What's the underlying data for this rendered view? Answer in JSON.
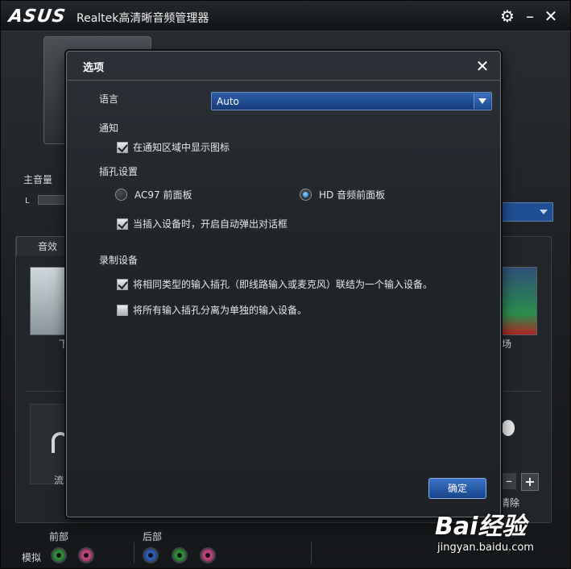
{
  "window": {
    "logo": "ASUS",
    "title": "Realtek高清晰音频管理器"
  },
  "background": {
    "main_volume_label": "主音量",
    "volume_l": "L",
    "sound_effects_tab": "音效",
    "partial_left_label": "下",
    "partial_right_label": "场",
    "partial_left_label2": "流",
    "partial_right_label2": "清除",
    "front_label": "前部",
    "rear_label": "后部",
    "analog_label": "模拟"
  },
  "dialog": {
    "title": "选项",
    "language_label": "语言",
    "language_value": "Auto",
    "notification_label": "通知",
    "show_icon_option": "在通知区域中显示图标",
    "show_icon_checked": true,
    "jack_settings_label": "插孔设置",
    "ac97_option": "AC97 前面板",
    "hd_option": "HD 音频前面板",
    "hd_selected": true,
    "auto_popup_option": "当插入设备时，开启自动弹出对话框",
    "auto_popup_checked": true,
    "recording_label": "录制设备",
    "tie_inputs_option": "将相同类型的输入插孔（即线路输入或麦克风）联结为一个输入设备。",
    "tie_inputs_checked": true,
    "separate_inputs_option": "将所有输入插孔分离为单独的输入设备。",
    "separate_inputs_checked": false,
    "ok_button": "确定"
  },
  "watermark": {
    "brand": "Bai经验",
    "url": "jingyan.baidu.com"
  },
  "colors": {
    "accent_blue": "#1f55a0",
    "dialog_bg": "#22272b",
    "jack_green": "#2f8f3a",
    "jack_pink": "#c0457f",
    "jack_blue": "#2f5fb8"
  },
  "icons": [
    "gear-icon",
    "minimize-icon",
    "close-icon",
    "dropdown-arrow-icon",
    "headphone-icon"
  ]
}
